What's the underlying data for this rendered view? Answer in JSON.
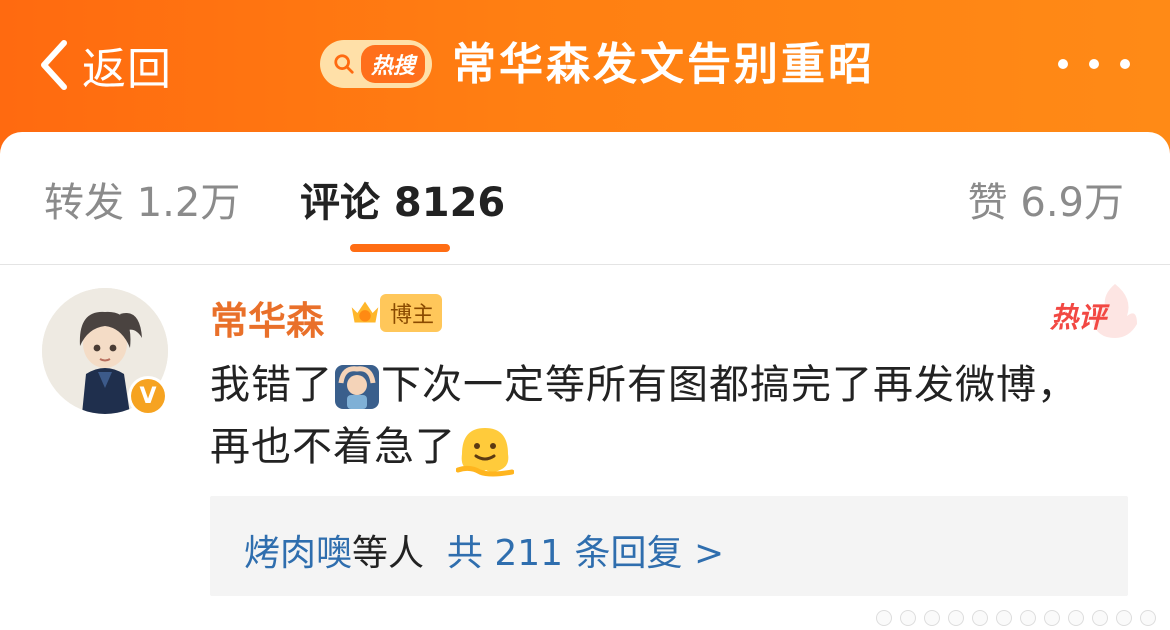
{
  "header": {
    "back_label": "返回",
    "hot_badge": "热搜",
    "topic_title": "常华森发文告别重昭",
    "more_icon": "more-icon"
  },
  "tabs": {
    "repost": "转发 1.2万",
    "comment": "评论 8126",
    "like": "赞 6.9万"
  },
  "comment": {
    "username": "常华森",
    "badge_label": "博主",
    "hot_tag": "热评",
    "text_part1": "我错了",
    "text_part2": "下次一定等所有图都搞完了再发微博，再也不着急了",
    "verified_mark": "V",
    "replies": {
      "user": "烤肉噢",
      "middle": "等人",
      "count_text": "共 211 条回复 >"
    }
  },
  "colors": {
    "header": "#ff7a14",
    "accent": "#ff6d14",
    "username": "#e9702a",
    "hot_comment": "#f24843",
    "link": "#2f6eae"
  }
}
